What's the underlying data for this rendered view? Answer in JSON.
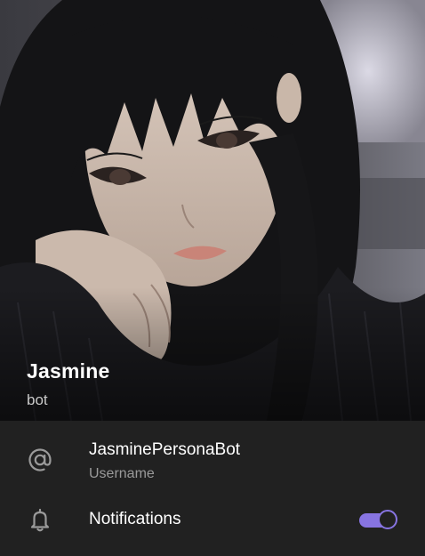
{
  "profile": {
    "name": "Jasmine",
    "status": "bot"
  },
  "info": {
    "username": {
      "value": "JasminePersonaBot",
      "label": "Username",
      "icon": "at-sign-icon"
    },
    "notifications": {
      "label": "Notifications",
      "icon": "bell-icon",
      "enabled": true
    }
  },
  "colors": {
    "accent": "#8774e1",
    "background": "#212121",
    "secondary_text": "#9a9a9a"
  }
}
